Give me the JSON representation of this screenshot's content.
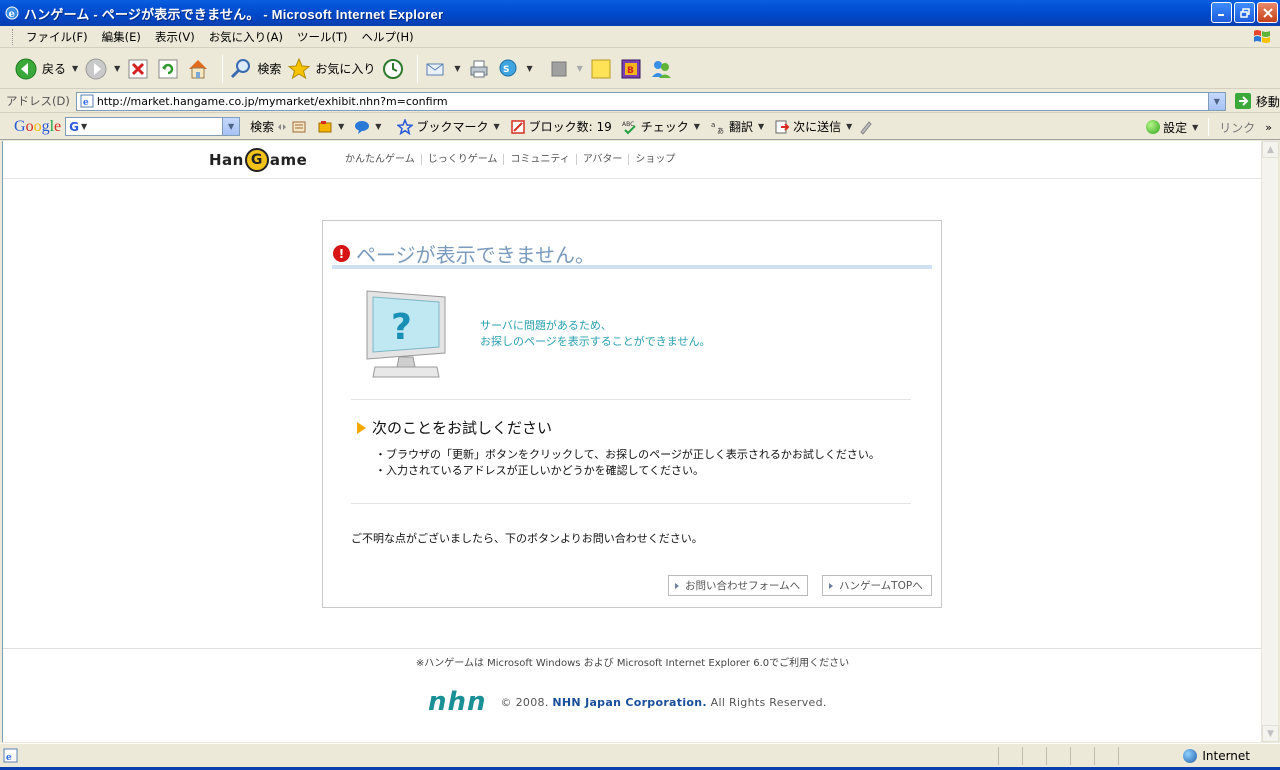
{
  "window": {
    "title": "ハンゲーム - ページが表示できません。 - Microsoft Internet Explorer"
  },
  "menu": [
    "ファイル(F)",
    "編集(E)",
    "表示(V)",
    "お気に入り(A)",
    "ツール(T)",
    "ヘルプ(H)"
  ],
  "toolbar": {
    "back_label": "戻る",
    "search_label": "検索",
    "favorites_label": "お気に入り"
  },
  "address": {
    "label": "アドレス(D)",
    "url": "http://market.hangame.co.jp/mymarket/exhibit.nhn?m=confirm",
    "go_label": "移動"
  },
  "google_bar": {
    "input_value": "G",
    "search_label": "検索",
    "bookmarks_label": "ブックマーク",
    "block_label": "ブロック数: 19",
    "check_label": "チェック",
    "translate_label": "翻訳",
    "send_label": "次に送信",
    "settings_label": "設定",
    "links_label": "リンク"
  },
  "site": {
    "logo_left": "Han",
    "logo_g": "G",
    "logo_right": "ame",
    "nav": [
      "かんたんゲーム",
      "じっくりゲーム",
      "コミュニティ",
      "アバター",
      "ショップ"
    ]
  },
  "error": {
    "title": "ページが表示できません。",
    "message_line1": "サーバに問題があるため、",
    "message_line2": "お探しのページを表示することができません。",
    "try_title": "次のことをお試しください",
    "try_items": [
      "・ブラウザの「更新」ボタンをクリックして、お探しのページが正しく表示されるかお試しください。",
      "・入力されているアドレスが正しいかどうかを確認してください。"
    ],
    "inquiry": "ご不明な点がございましたら、下のボタンよりお問い合わせください。",
    "btn_contact": "お問い合わせフォームへ",
    "btn_top": "ハンゲームTOPへ"
  },
  "footer": {
    "note": "※ハンゲームは Microsoft Windows および Microsoft Internet Explorer 6.0でご利用ください",
    "nhn_logo": "nhn",
    "copy_prefix": "© 2008.",
    "copy_company": "NHN Japan Corporation.",
    "copy_suffix": "All Rights Reserved."
  },
  "status": {
    "zone": "Internet"
  },
  "colors": {
    "accent": "#7a9bbd",
    "message": "#2aa0b0",
    "error_red": "#d71313",
    "nhn_teal": "#1a8f95"
  }
}
